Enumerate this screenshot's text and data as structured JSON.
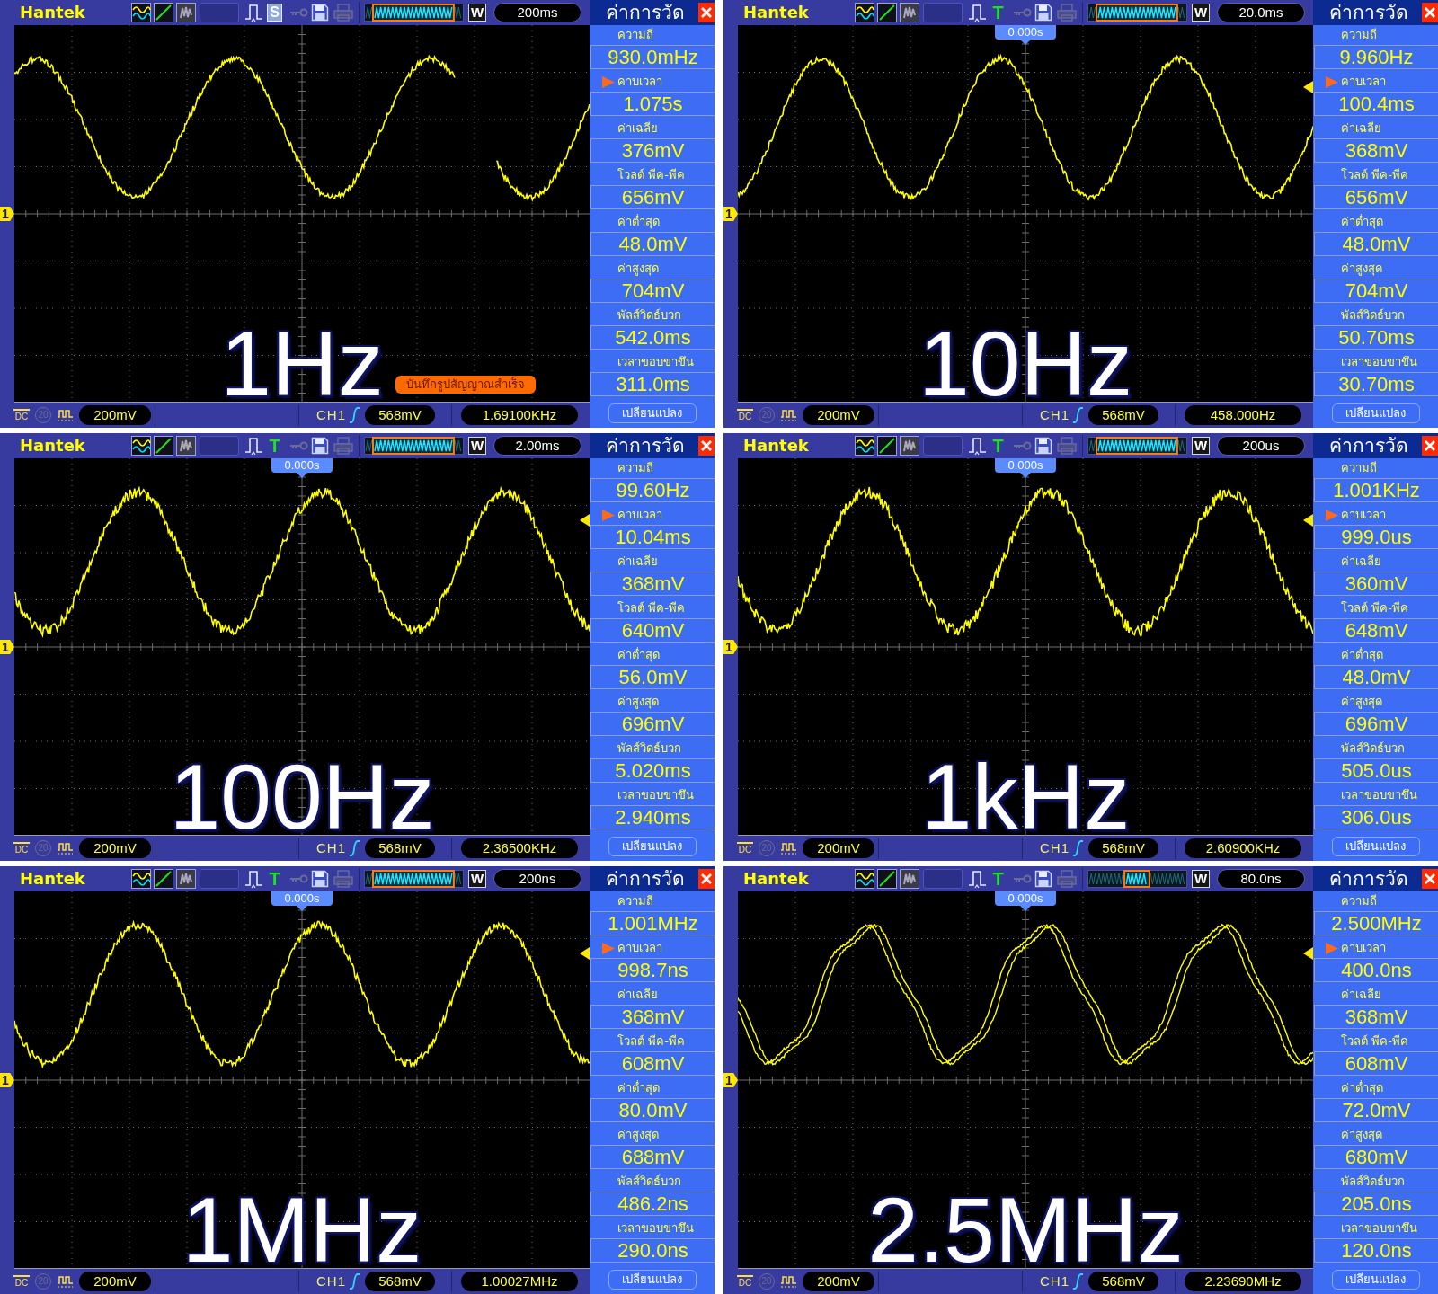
{
  "panels": [
    {
      "toolbar": {
        "logo": "Hantek",
        "trigger_status": {
          "kind": "stopped",
          "label": "S"
        },
        "memory_bar": {
          "kind": "wide"
        },
        "w_button": "W",
        "timebase": "200ms"
      },
      "display": {
        "channel_marker": "1",
        "caption": "1Hz",
        "notification": "บันทึกรูปสัญญาณสำเร็จ"
      },
      "measurements": {
        "title": "ค่าการวัด",
        "items": [
          {
            "label": "ความถี",
            "value": "930.0mHz",
            "selected": false
          },
          {
            "label": "คาบเวลา",
            "value": "1.075s",
            "selected": true
          },
          {
            "label": "ค่าเฉลีย",
            "value": "376mV",
            "selected": false
          },
          {
            "label": "โวลต์ พีค-พีค",
            "value": "656mV",
            "selected": false
          },
          {
            "label": "ค่าต่ำสุด",
            "value": "48.0mV",
            "selected": false
          },
          {
            "label": "ค่าสูงสุด",
            "value": "704mV",
            "selected": false
          },
          {
            "label": "พัลส์วิดธ์บวก",
            "value": "542.0ms",
            "selected": false
          },
          {
            "label": "เวลาขอบขาขึน",
            "value": "311.0ms",
            "selected": false
          }
        ],
        "button": "เปลียนแปลง"
      },
      "status_bar": {
        "coupling": "DC",
        "bandwidth_limit": {
          "label": "20",
          "on": false
        },
        "volts_per_div": "200mV",
        "channel": "CH1",
        "trigger_level": "568mV",
        "frequency": "1.69100KHz"
      }
    },
    {
      "toolbar": {
        "logo": "Hantek",
        "trigger_status": {
          "kind": "triggered",
          "label": "T"
        },
        "memory_bar": {
          "kind": "wide"
        },
        "w_button": "W",
        "timebase": "20.0ms"
      },
      "display": {
        "trigger_position": "0.000s",
        "channel_marker": "1",
        "trigger_level_marker": true,
        "caption": "10Hz"
      },
      "measurements": {
        "title": "ค่าการวัด",
        "items": [
          {
            "label": "ความถี",
            "value": "9.960Hz",
            "selected": false
          },
          {
            "label": "คาบเวลา",
            "value": "100.4ms",
            "selected": true
          },
          {
            "label": "ค่าเฉลีย",
            "value": "368mV",
            "selected": false
          },
          {
            "label": "โวลต์ พีค-พีค",
            "value": "656mV",
            "selected": false
          },
          {
            "label": "ค่าต่ำสุด",
            "value": "48.0mV",
            "selected": false
          },
          {
            "label": "ค่าสูงสุด",
            "value": "704mV",
            "selected": false
          },
          {
            "label": "พัลส์วิดธ์บวก",
            "value": "50.70ms",
            "selected": false
          },
          {
            "label": "เวลาขอบขาขึน",
            "value": "30.70ms",
            "selected": false
          }
        ],
        "button": "เปลียนแปลง"
      },
      "status_bar": {
        "coupling": "DC",
        "bandwidth_limit": {
          "label": "20",
          "on": false
        },
        "volts_per_div": "200mV",
        "channel": "CH1",
        "trigger_level": "568mV",
        "frequency": "458.000Hz"
      }
    },
    {
      "toolbar": {
        "logo": "Hantek",
        "trigger_status": {
          "kind": "triggered",
          "label": "T"
        },
        "memory_bar": {
          "kind": "wide"
        },
        "w_button": "W",
        "timebase": "2.00ms"
      },
      "display": {
        "trigger_position": "0.000s",
        "channel_marker": "1",
        "trigger_level_marker": true,
        "caption": "100Hz"
      },
      "measurements": {
        "title": "ค่าการวัด",
        "items": [
          {
            "label": "ความถี",
            "value": "99.60Hz",
            "selected": false
          },
          {
            "label": "คาบเวลา",
            "value": "10.04ms",
            "selected": true
          },
          {
            "label": "ค่าเฉลีย",
            "value": "368mV",
            "selected": false
          },
          {
            "label": "โวลต์ พีค-พีค",
            "value": "640mV",
            "selected": false
          },
          {
            "label": "ค่าต่ำสุด",
            "value": "56.0mV",
            "selected": false
          },
          {
            "label": "ค่าสูงสุด",
            "value": "696mV",
            "selected": false
          },
          {
            "label": "พัลส์วิดธ์บวก",
            "value": "5.020ms",
            "selected": false
          },
          {
            "label": "เวลาขอบขาขึน",
            "value": "2.940ms",
            "selected": false
          }
        ],
        "button": "เปลียนแปลง"
      },
      "status_bar": {
        "coupling": "DC",
        "bandwidth_limit": {
          "label": "20",
          "on": false
        },
        "volts_per_div": "200mV",
        "channel": "CH1",
        "trigger_level": "568mV",
        "frequency": "2.36500KHz"
      }
    },
    {
      "toolbar": {
        "logo": "Hantek",
        "trigger_status": {
          "kind": "triggered",
          "label": "T"
        },
        "memory_bar": {
          "kind": "wide"
        },
        "w_button": "W",
        "timebase": "200us"
      },
      "display": {
        "trigger_position": "0.000s",
        "channel_marker": "1",
        "trigger_level_marker": true,
        "caption": "1kHz"
      },
      "measurements": {
        "title": "ค่าการวัด",
        "items": [
          {
            "label": "ความถี",
            "value": "1.001KHz",
            "selected": false
          },
          {
            "label": "คาบเวลา",
            "value": "999.0us",
            "selected": true
          },
          {
            "label": "ค่าเฉลีย",
            "value": "360mV",
            "selected": false
          },
          {
            "label": "โวลต์ พีค-พีค",
            "value": "648mV",
            "selected": false
          },
          {
            "label": "ค่าต่ำสุด",
            "value": "48.0mV",
            "selected": false
          },
          {
            "label": "ค่าสูงสุด",
            "value": "696mV",
            "selected": false
          },
          {
            "label": "พัลส์วิดธ์บวก",
            "value": "505.0us",
            "selected": false
          },
          {
            "label": "เวลาขอบขาขึน",
            "value": "306.0us",
            "selected": false
          }
        ],
        "button": "เปลียนแปลง"
      },
      "status_bar": {
        "coupling": "DC",
        "bandwidth_limit": {
          "label": "20",
          "on": false
        },
        "volts_per_div": "200mV",
        "channel": "CH1",
        "trigger_level": "568mV",
        "frequency": "2.60900KHz"
      }
    },
    {
      "toolbar": {
        "logo": "Hantek",
        "trigger_status": {
          "kind": "triggered",
          "label": "T"
        },
        "memory_bar": {
          "kind": "wide"
        },
        "w_button": "W",
        "timebase": "200ns"
      },
      "display": {
        "trigger_position": "0.000s",
        "channel_marker": "1",
        "trigger_level_marker": true,
        "caption": "1MHz"
      },
      "measurements": {
        "title": "ค่าการวัด",
        "items": [
          {
            "label": "ความถี",
            "value": "1.001MHz",
            "selected": false
          },
          {
            "label": "คาบเวลา",
            "value": "998.7ns",
            "selected": true
          },
          {
            "label": "ค่าเฉลีย",
            "value": "368mV",
            "selected": false
          },
          {
            "label": "โวลต์ พีค-พีค",
            "value": "608mV",
            "selected": false
          },
          {
            "label": "ค่าต่ำสุด",
            "value": "80.0mV",
            "selected": false
          },
          {
            "label": "ค่าสูงสุด",
            "value": "688mV",
            "selected": false
          },
          {
            "label": "พัลส์วิดธ์บวก",
            "value": "486.2ns",
            "selected": false
          },
          {
            "label": "เวลาขอบขาขึน",
            "value": "290.0ns",
            "selected": false
          }
        ],
        "button": "เปลียนแปลง"
      },
      "status_bar": {
        "coupling": "DC",
        "bandwidth_limit": {
          "label": "20",
          "on": false
        },
        "volts_per_div": "200mV",
        "channel": "CH1",
        "trigger_level": "568mV",
        "frequency": "1.00027MHz"
      }
    },
    {
      "toolbar": {
        "logo": "Hantek",
        "trigger_status": {
          "kind": "triggered",
          "label": "T"
        },
        "memory_bar": {
          "kind": "narrow"
        },
        "w_button": "W",
        "timebase": "80.0ns"
      },
      "display": {
        "trigger_position": "0.000s",
        "channel_marker": "1",
        "trigger_level_marker": true,
        "caption": "2.5MHz"
      },
      "measurements": {
        "title": "ค่าการวัด",
        "items": [
          {
            "label": "ความถี",
            "value": "2.500MHz",
            "selected": false
          },
          {
            "label": "คาบเวลา",
            "value": "400.0ns",
            "selected": true
          },
          {
            "label": "ค่าเฉลีย",
            "value": "368mV",
            "selected": false
          },
          {
            "label": "โวลต์ พีค-พีค",
            "value": "608mV",
            "selected": false
          },
          {
            "label": "ค่าต่ำสุด",
            "value": "72.0mV",
            "selected": false
          },
          {
            "label": "ค่าสูงสุด",
            "value": "680mV",
            "selected": false
          },
          {
            "label": "พัลส์วิดธ์บวก",
            "value": "205.0ns",
            "selected": false
          },
          {
            "label": "เวลาขอบขาขึน",
            "value": "120.0ns",
            "selected": false
          }
        ],
        "button": "เปลียนแปลง"
      },
      "status_bar": {
        "coupling": "DC",
        "bandwidth_limit": {
          "label": "20",
          "on": false
        },
        "volts_per_div": "200mV",
        "channel": "CH1",
        "trigger_level": "568mV",
        "frequency": "2.23690MHz"
      }
    }
  ]
}
